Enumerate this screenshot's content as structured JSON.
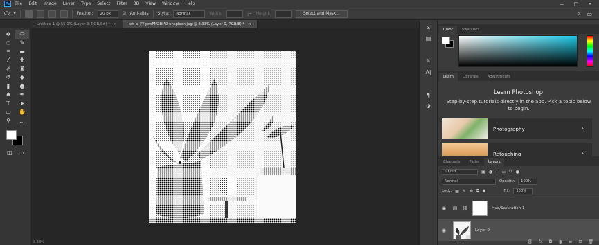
{
  "menu": {
    "logo": "Ps",
    "items": [
      "File",
      "Edit",
      "Image",
      "Layer",
      "Type",
      "Select",
      "Filter",
      "3D",
      "View",
      "Window",
      "Help"
    ],
    "window_controls": [
      "—",
      "□",
      "✕"
    ]
  },
  "options": {
    "feather_label": "Feather:",
    "feather_value": "20 px",
    "antialias_label": "Anti-alias",
    "style_label": "Style:",
    "style_value": "Normal",
    "width_label": "Width:",
    "height_label": "Height:",
    "select_mask_label": "Select and Mask..."
  },
  "document_tabs": [
    {
      "label": "Untitled-1 @ 55.1% (Layer 3, RGB/8#) *",
      "close": "×"
    },
    {
      "label": "leh-le-FYgewFMZBM0-unsplash.jpg @ 8.33% (Layer 0, RGB/8) *",
      "close": "×"
    }
  ],
  "status": {
    "zoom": "8.33%"
  },
  "color_panel": {
    "tabs": [
      "Color",
      "Swatches"
    ]
  },
  "learn_panel": {
    "tabs": [
      "Learn",
      "Libraries",
      "Adjustments"
    ],
    "title": "Learn Photoshop",
    "description": "Step-by-step tutorials directly in the app. Pick a topic below to begin.",
    "cards": [
      {
        "label": "Photography"
      },
      {
        "label": "Retouching"
      }
    ]
  },
  "layers_panel": {
    "tabs": [
      "Channels",
      "Paths",
      "Layers"
    ],
    "kind_label": "Kind",
    "blend_mode": "Normal",
    "opacity_label": "Opacity:",
    "opacity_value": "100%",
    "lock_label": "Lock:",
    "fill_label": "Fill:",
    "fill_value": "100%",
    "layers": [
      {
        "name": "Hue/Saturation 1"
      },
      {
        "name": "Layer 0"
      }
    ]
  },
  "colors": {
    "accent": "#31a8ff",
    "panel_bg": "#3b3b3b",
    "canvas_bg": "#262626",
    "selected_layer": "#4f4f4f"
  }
}
